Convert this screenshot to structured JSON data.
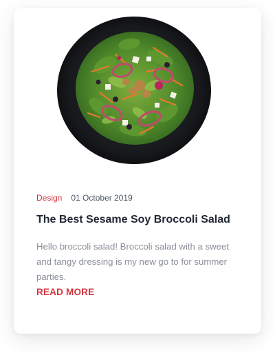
{
  "card": {
    "image_alt": "broccoli salad plate",
    "category": "Design",
    "date": "01 October 2019",
    "title": "The Best Sesame Soy Broccoli Salad",
    "excerpt": "Hello broccoli salad! Broccoli salad with a sweet and tangy dressing is my new go to for summer parties.",
    "read_more": "READ MORE"
  },
  "colors": {
    "accent": "#d2343f",
    "title": "#1f2733",
    "body_text": "#8a8f99",
    "meta_text": "#4a5566",
    "plate": "#1b1d22"
  }
}
